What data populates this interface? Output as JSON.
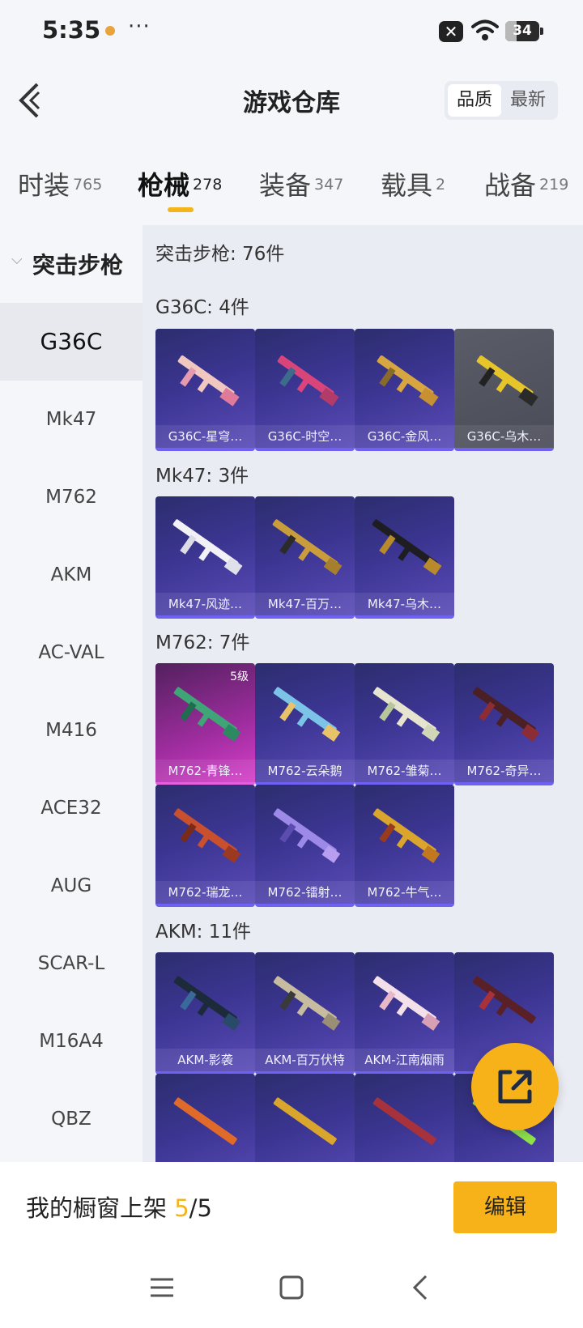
{
  "status": {
    "time": "5:35",
    "more": "···",
    "close_glyph": "✕",
    "battery": "34",
    "battery_level": 0.34
  },
  "header": {
    "title": "游戏仓库",
    "sort_options": [
      "品质",
      "最新"
    ],
    "active_sort": "品质"
  },
  "tabs": [
    {
      "label": "时装",
      "count": "765"
    },
    {
      "label": "枪械",
      "count": "278",
      "active": true
    },
    {
      "label": "装备",
      "count": "347"
    },
    {
      "label": "载具",
      "count": "2"
    },
    {
      "label": "战备",
      "count": "219"
    }
  ],
  "sidebar": {
    "category": "突击步枪",
    "items": [
      "G36C",
      "Mk47",
      "M762",
      "AKM",
      "AC-VAL",
      "M416",
      "ACE32",
      "AUG",
      "SCAR-L",
      "M16A4",
      "QBZ"
    ],
    "active": "G36C"
  },
  "content": {
    "total": "突击步枪: 76件",
    "groups": [
      {
        "title": "G36C: 4件",
        "items": [
          "G36C-星穹…",
          "G36C-时空…",
          "G36C-金风…",
          "G36C-乌木…"
        ]
      },
      {
        "title": "Mk47: 3件",
        "items": [
          "Mk47-风迹…",
          "Mk47-百万…",
          "Mk47-乌木…"
        ]
      },
      {
        "title": "M762: 7件",
        "items": [
          "M762-青锋…",
          "M762-云朵鹅",
          "M762-雏菊…",
          "M762-奇异…",
          "M762-瑞龙…",
          "M762-镭射…",
          "M762-牛气…"
        ],
        "level_badge": "5级"
      },
      {
        "title": "AKM: 11件",
        "items": [
          "AKM-影袭",
          "AKM-百万伏特",
          "AKM-江南烟雨"
        ]
      }
    ]
  },
  "colors": {
    "accent": "#f7b21a",
    "card_bg": "#3b3591",
    "card_border": "#6f61f1"
  },
  "footer": {
    "showcase_label": "我的橱窗上架 ",
    "showcase_current": "5",
    "showcase_total": "/5",
    "edit_label": "编辑"
  },
  "icons": [
    "back-arrow-icon",
    "share-icon",
    "menu-icon",
    "home-icon",
    "back-icon",
    "wifi-icon"
  ]
}
